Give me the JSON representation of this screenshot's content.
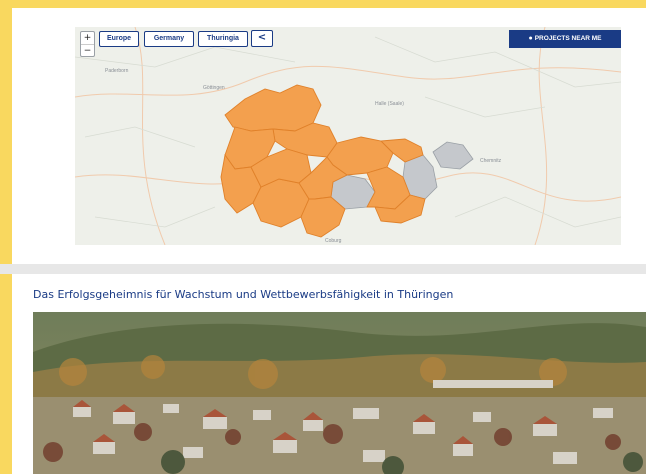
{
  "map": {
    "zoom_in": "+",
    "zoom_out": "−",
    "breadcrumbs": [
      "Europe",
      "Germany",
      "Thuringia"
    ],
    "back_label": "<",
    "projects_near_me": "PROJECTS NEAR ME",
    "colors": {
      "active_region": "#f3a04e",
      "inactive_region": "#c5c8cc",
      "button": "#1a3b85"
    }
  },
  "article": {
    "title": "Das Erfolgsgeheimnis für Wachstum und Wettbewerbsfähigkeit in Thüringen"
  }
}
